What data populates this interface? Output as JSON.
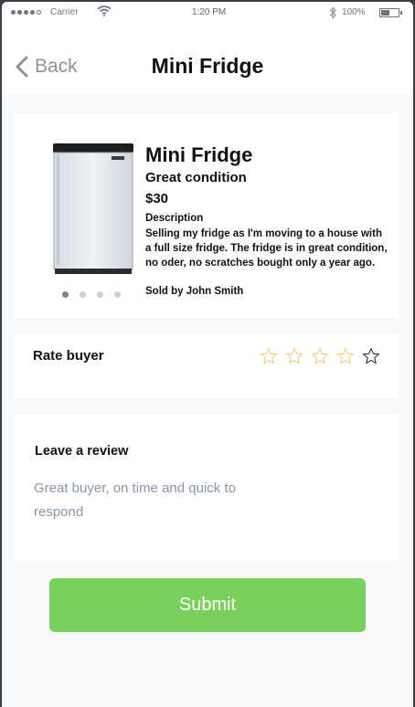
{
  "status_bar": {
    "carrier": "Carrier",
    "time": "1:20 PM",
    "battery": "100%"
  },
  "nav": {
    "back_label": "Back",
    "title": "Mini Fridge"
  },
  "product": {
    "name": "Mini Fridge",
    "condition": "Great condition",
    "price": "$30",
    "description_label": "Description",
    "description": "Selling my fridge as I'm moving to a house with a full size fridge. The fridge is in great condition, no oder, no scratches bought only a year ago.",
    "seller": "Sold by John Smith",
    "image_pager": {
      "count": 4,
      "active": 1
    }
  },
  "rating": {
    "label": "Rate buyer",
    "max": 5,
    "value": 0,
    "star_colors": [
      "#f1c76a",
      "#f1c76a",
      "#f1c76a",
      "#f1c76a",
      "#222222"
    ]
  },
  "review": {
    "label": "Leave a review",
    "text": "Great buyer, on time and quick to respond"
  },
  "submit_label": "Submit",
  "colors": {
    "accent_green": "#7ad05c",
    "background": "#f7f9fb",
    "muted_text": "#8a97a8"
  }
}
